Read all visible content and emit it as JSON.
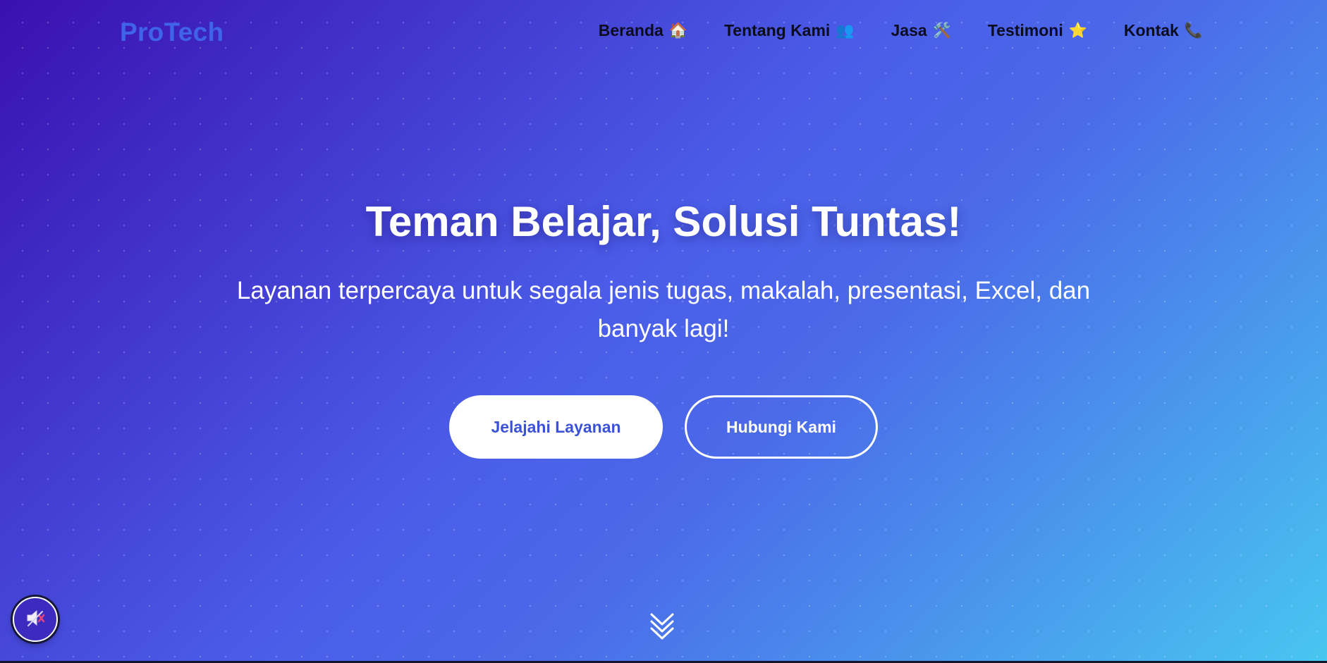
{
  "brand": {
    "name": "ProTech",
    "color": "#3f63ea"
  },
  "nav": {
    "items": [
      {
        "label": "Beranda",
        "icon": "🏠",
        "icon_name": "house-icon"
      },
      {
        "label": "Tentang Kami",
        "icon": "👥",
        "icon_name": "people-icon"
      },
      {
        "label": "Jasa",
        "icon": "🛠️",
        "icon_name": "tools-icon"
      },
      {
        "label": "Testimoni",
        "icon": "⭐",
        "icon_name": "star-icon"
      },
      {
        "label": "Kontak",
        "icon": "📞",
        "icon_name": "phone-icon"
      }
    ]
  },
  "hero": {
    "title": "Teman Belajar, Solusi Tuntas!",
    "subtitle": "Layanan terpercaya untuk segala jenis tugas, makalah, presentasi, Excel, dan banyak lagi!",
    "primary_button": "Jelajahi Layanan",
    "secondary_button": "Hubungi Kami"
  },
  "scroll_indicator": {
    "icon_name": "double-chevron-down-icon"
  },
  "sound_toggle": {
    "icon_name": "speaker-muted-icon",
    "state": "muted"
  },
  "colors": {
    "gradient_start": "#3a10b0",
    "gradient_mid": "#4a5ce8",
    "gradient_end": "#48c6f0",
    "primary_button_text": "#3c52d6"
  }
}
